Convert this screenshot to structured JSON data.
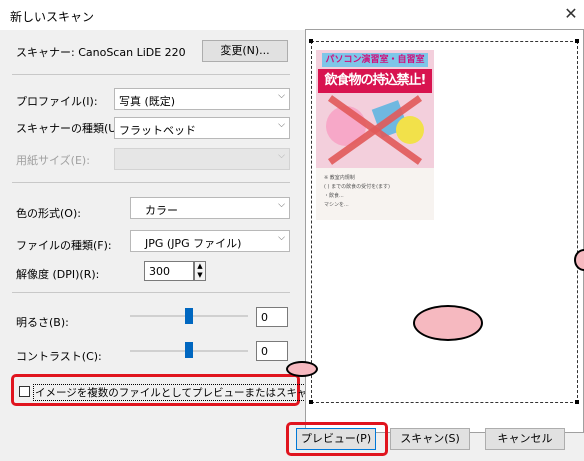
{
  "window": {
    "title": "新しいスキャン",
    "close_glyph": "✕"
  },
  "scanner": {
    "label": "スキャナー: CanoScan LiDE 220",
    "change_button": "変更(N)..."
  },
  "profile": {
    "label": "プロファイル(I):",
    "value": "写真 (既定)"
  },
  "scanner_type": {
    "label": "スキャナーの種類(U):",
    "value": "フラットベッド"
  },
  "paper_size": {
    "label": "用紙サイズ(E):",
    "value": ""
  },
  "color_format": {
    "label": "色の形式(O):",
    "value": "カラー"
  },
  "file_type": {
    "label": "ファイルの種類(F):",
    "value": "JPG (JPG ファイル)"
  },
  "resolution": {
    "label": "解像度 (DPI)(R):",
    "value": "300"
  },
  "brightness": {
    "label": "明るさ(B):",
    "value": "0"
  },
  "contrast": {
    "label": "コントラスト(C):",
    "value": "0"
  },
  "multi_file_checkbox": {
    "label": "イメージを複数のファイルとしてプレビューまたはスキャンする(T)",
    "checked": false
  },
  "buttons": {
    "preview": "プレビュー(P)",
    "scan": "スキャン(S)",
    "cancel": "キャンセル"
  },
  "preview_image": {
    "banner": "パソコン演習室・自習室",
    "headline": "飲食物の持込禁止!",
    "caption_1": "※ 教室内規制",
    "caption_2": "( ) までの飲食の受付を(ます)",
    "caption_3": "・飲食...",
    "caption_4": "マシンを..."
  },
  "colors": {
    "highlight_red": "#e0141e",
    "oval_fill": "#f6b9c0",
    "accent_blue": "#0067c0"
  }
}
